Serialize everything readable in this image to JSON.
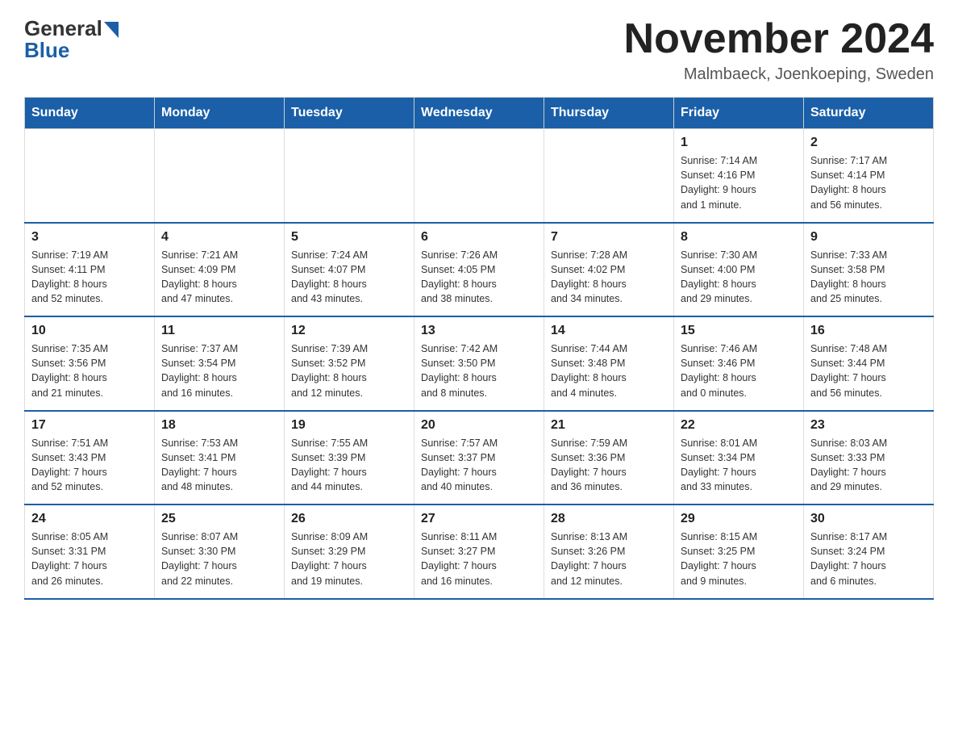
{
  "header": {
    "logo_line1": "General",
    "logo_line2": "Blue",
    "calendar_title": "November 2024",
    "calendar_subtitle": "Malmbaeck, Joenkoeping, Sweden"
  },
  "days_of_week": [
    "Sunday",
    "Monday",
    "Tuesday",
    "Wednesday",
    "Thursday",
    "Friday",
    "Saturday"
  ],
  "weeks": [
    [
      {
        "day": "",
        "info": ""
      },
      {
        "day": "",
        "info": ""
      },
      {
        "day": "",
        "info": ""
      },
      {
        "day": "",
        "info": ""
      },
      {
        "day": "",
        "info": ""
      },
      {
        "day": "1",
        "info": "Sunrise: 7:14 AM\nSunset: 4:16 PM\nDaylight: 9 hours\nand 1 minute."
      },
      {
        "day": "2",
        "info": "Sunrise: 7:17 AM\nSunset: 4:14 PM\nDaylight: 8 hours\nand 56 minutes."
      }
    ],
    [
      {
        "day": "3",
        "info": "Sunrise: 7:19 AM\nSunset: 4:11 PM\nDaylight: 8 hours\nand 52 minutes."
      },
      {
        "day": "4",
        "info": "Sunrise: 7:21 AM\nSunset: 4:09 PM\nDaylight: 8 hours\nand 47 minutes."
      },
      {
        "day": "5",
        "info": "Sunrise: 7:24 AM\nSunset: 4:07 PM\nDaylight: 8 hours\nand 43 minutes."
      },
      {
        "day": "6",
        "info": "Sunrise: 7:26 AM\nSunset: 4:05 PM\nDaylight: 8 hours\nand 38 minutes."
      },
      {
        "day": "7",
        "info": "Sunrise: 7:28 AM\nSunset: 4:02 PM\nDaylight: 8 hours\nand 34 minutes."
      },
      {
        "day": "8",
        "info": "Sunrise: 7:30 AM\nSunset: 4:00 PM\nDaylight: 8 hours\nand 29 minutes."
      },
      {
        "day": "9",
        "info": "Sunrise: 7:33 AM\nSunset: 3:58 PM\nDaylight: 8 hours\nand 25 minutes."
      }
    ],
    [
      {
        "day": "10",
        "info": "Sunrise: 7:35 AM\nSunset: 3:56 PM\nDaylight: 8 hours\nand 21 minutes."
      },
      {
        "day": "11",
        "info": "Sunrise: 7:37 AM\nSunset: 3:54 PM\nDaylight: 8 hours\nand 16 minutes."
      },
      {
        "day": "12",
        "info": "Sunrise: 7:39 AM\nSunset: 3:52 PM\nDaylight: 8 hours\nand 12 minutes."
      },
      {
        "day": "13",
        "info": "Sunrise: 7:42 AM\nSunset: 3:50 PM\nDaylight: 8 hours\nand 8 minutes."
      },
      {
        "day": "14",
        "info": "Sunrise: 7:44 AM\nSunset: 3:48 PM\nDaylight: 8 hours\nand 4 minutes."
      },
      {
        "day": "15",
        "info": "Sunrise: 7:46 AM\nSunset: 3:46 PM\nDaylight: 8 hours\nand 0 minutes."
      },
      {
        "day": "16",
        "info": "Sunrise: 7:48 AM\nSunset: 3:44 PM\nDaylight: 7 hours\nand 56 minutes."
      }
    ],
    [
      {
        "day": "17",
        "info": "Sunrise: 7:51 AM\nSunset: 3:43 PM\nDaylight: 7 hours\nand 52 minutes."
      },
      {
        "day": "18",
        "info": "Sunrise: 7:53 AM\nSunset: 3:41 PM\nDaylight: 7 hours\nand 48 minutes."
      },
      {
        "day": "19",
        "info": "Sunrise: 7:55 AM\nSunset: 3:39 PM\nDaylight: 7 hours\nand 44 minutes."
      },
      {
        "day": "20",
        "info": "Sunrise: 7:57 AM\nSunset: 3:37 PM\nDaylight: 7 hours\nand 40 minutes."
      },
      {
        "day": "21",
        "info": "Sunrise: 7:59 AM\nSunset: 3:36 PM\nDaylight: 7 hours\nand 36 minutes."
      },
      {
        "day": "22",
        "info": "Sunrise: 8:01 AM\nSunset: 3:34 PM\nDaylight: 7 hours\nand 33 minutes."
      },
      {
        "day": "23",
        "info": "Sunrise: 8:03 AM\nSunset: 3:33 PM\nDaylight: 7 hours\nand 29 minutes."
      }
    ],
    [
      {
        "day": "24",
        "info": "Sunrise: 8:05 AM\nSunset: 3:31 PM\nDaylight: 7 hours\nand 26 minutes."
      },
      {
        "day": "25",
        "info": "Sunrise: 8:07 AM\nSunset: 3:30 PM\nDaylight: 7 hours\nand 22 minutes."
      },
      {
        "day": "26",
        "info": "Sunrise: 8:09 AM\nSunset: 3:29 PM\nDaylight: 7 hours\nand 19 minutes."
      },
      {
        "day": "27",
        "info": "Sunrise: 8:11 AM\nSunset: 3:27 PM\nDaylight: 7 hours\nand 16 minutes."
      },
      {
        "day": "28",
        "info": "Sunrise: 8:13 AM\nSunset: 3:26 PM\nDaylight: 7 hours\nand 12 minutes."
      },
      {
        "day": "29",
        "info": "Sunrise: 8:15 AM\nSunset: 3:25 PM\nDaylight: 7 hours\nand 9 minutes."
      },
      {
        "day": "30",
        "info": "Sunrise: 8:17 AM\nSunset: 3:24 PM\nDaylight: 7 hours\nand 6 minutes."
      }
    ]
  ]
}
